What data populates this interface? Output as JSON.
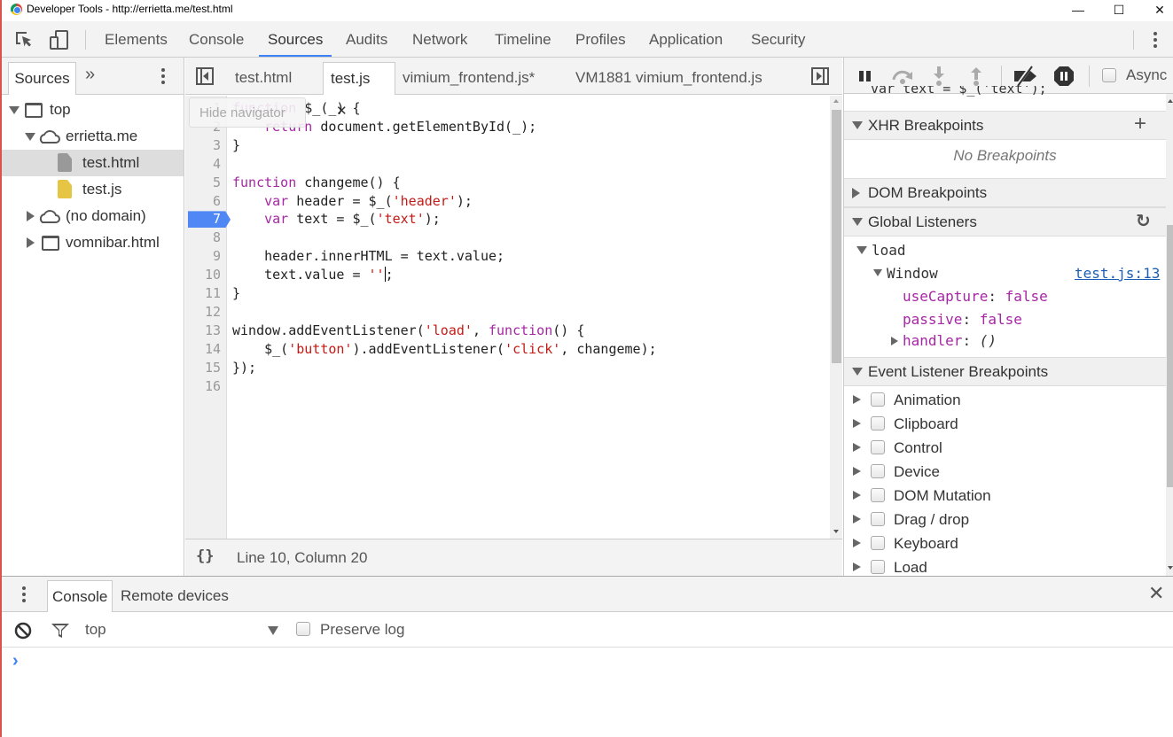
{
  "window": {
    "title": "Developer Tools - http://errietta.me/test.html",
    "minimize_icon": "minimize-icon",
    "maximize_icon": "maximize-icon",
    "close_icon": "close-icon",
    "min_glyph": "—",
    "max_glyph": "☐",
    "close_glyph": "✕"
  },
  "main_toolbar": {
    "tabs": [
      {
        "label": "Elements"
      },
      {
        "label": "Console"
      },
      {
        "label": "Sources",
        "active": true
      },
      {
        "label": "Audits"
      },
      {
        "label": "Network"
      },
      {
        "label": "Timeline"
      },
      {
        "label": "Profiles"
      },
      {
        "label": "Application"
      },
      {
        "label": "Security"
      }
    ]
  },
  "navigator": {
    "tab_label": "Sources",
    "more_glyph": "»",
    "tree": [
      {
        "label": "top",
        "icon": "frame-icon",
        "expanded": true
      },
      {
        "label": "errietta.me",
        "icon": "cloud-icon",
        "expanded": true
      },
      {
        "label": "test.html",
        "icon": "file-icon",
        "selected": true
      },
      {
        "label": "test.js",
        "icon": "script-file-icon"
      },
      {
        "label": "(no domain)",
        "icon": "cloud-icon",
        "expanded": false
      },
      {
        "label": "vomnibar.html",
        "icon": "frame-icon",
        "expanded": false
      }
    ]
  },
  "editor": {
    "tabs": [
      {
        "label": "test.html"
      },
      {
        "label": "test.js",
        "active": true,
        "close": "✕"
      },
      {
        "label": "vimium_frontend.js*"
      },
      {
        "label": "VM1881 vimium_frontend.js"
      }
    ],
    "tooltip": "Hide navigator",
    "breakpoint_line": 7,
    "lines": [
      {
        "n": "1",
        "html": "<span class=\"kw\">function</span> $_(_) {"
      },
      {
        "n": "2",
        "html": "    <span class=\"kw\">return</span> document.getElementById(_);"
      },
      {
        "n": "3",
        "html": "}"
      },
      {
        "n": "4",
        "html": ""
      },
      {
        "n": "5",
        "html": "<span class=\"kw\">function</span> changeme() {"
      },
      {
        "n": "6",
        "html": "    <span class=\"kw\">var</span> header = $_(<span class=\"str\">'header'</span>);"
      },
      {
        "n": "7",
        "html": "    <span class=\"kw\">var</span> text = $_(<span class=\"str\">'text'</span>);"
      },
      {
        "n": "8",
        "html": ""
      },
      {
        "n": "9",
        "html": "    header.innerHTML = text.value;"
      },
      {
        "n": "10",
        "html": "    text.value = <span class=\"str\">''</span><span class=\"caret\"></span>;"
      },
      {
        "n": "11",
        "html": "}"
      },
      {
        "n": "12",
        "html": ""
      },
      {
        "n": "13",
        "html": "window.addEventListener(<span class=\"str\">'load'</span>, <span class=\"kw\">function</span>() {"
      },
      {
        "n": "14",
        "html": "    $_(<span class=\"str\">'button'</span>).addEventListener(<span class=\"str\">'click'</span>, changeme);"
      },
      {
        "n": "15",
        "html": "});"
      },
      {
        "n": "16",
        "html": ""
      }
    ],
    "status": {
      "format_glyph": "{}",
      "position": "Line 10, Column 20"
    }
  },
  "debugger": {
    "async_label": "Async",
    "partial_line": "var text = $_('text');",
    "xhr": {
      "title": "XHR Breakpoints",
      "add_glyph": "+",
      "empty": "No Breakpoints"
    },
    "dom": {
      "title": "DOM Breakpoints"
    },
    "global": {
      "title": "Global Listeners",
      "refresh_glyph": "↻",
      "event": "load",
      "target": "Window",
      "link": "test.js:13",
      "props": [
        {
          "key": "useCapture",
          "value": "false"
        },
        {
          "key": "passive",
          "value": "false"
        }
      ],
      "handler_key": "handler",
      "handler_value": "()"
    },
    "elb": {
      "title": "Event Listener Breakpoints",
      "items": [
        "Animation",
        "Clipboard",
        "Control",
        "Device",
        "DOM Mutation",
        "Drag / drop",
        "Keyboard",
        "Load"
      ]
    }
  },
  "drawer": {
    "tabs": [
      {
        "label": "Console",
        "active": true
      },
      {
        "label": "Remote devices"
      }
    ],
    "close_glyph": "✕",
    "context": "top",
    "preserve_log": "Preserve log",
    "prompt": "›"
  }
}
